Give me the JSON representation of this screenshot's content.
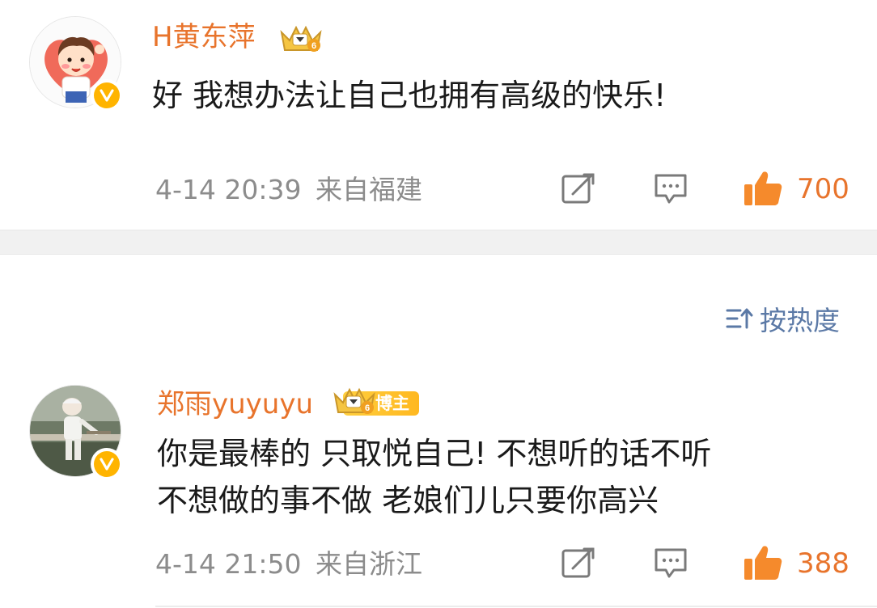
{
  "comments": [
    {
      "username": "H黄东萍",
      "text": "好 我想办法让自己也拥有高级的快乐!",
      "time": "4-14 20:39",
      "location": "来自福建",
      "likes": "700",
      "avatar_icon": "cartoon-boy-avatar",
      "badge_icon": "crown-level-6-icon"
    },
    {
      "username": "郑雨yuyuyu",
      "badge_label": "博主",
      "text_lines": [
        "你是最棒的 只取悦自己! 不想听的话不听",
        "不想做的事不做 老娘们儿只要你高兴"
      ],
      "time": "4-14 21:50",
      "location": "来自浙江",
      "likes": "388",
      "avatar_icon": "toddler-photo-avatar",
      "badge_icon": "crown-level-6-icon"
    }
  ],
  "sort": {
    "label": "按热度",
    "icon": "sort-icon"
  },
  "colors": {
    "accent": "#e8742c",
    "link_blue": "#5b79a6",
    "verify_gold": "#ffb400",
    "meta_gray": "#8c8c8c"
  }
}
